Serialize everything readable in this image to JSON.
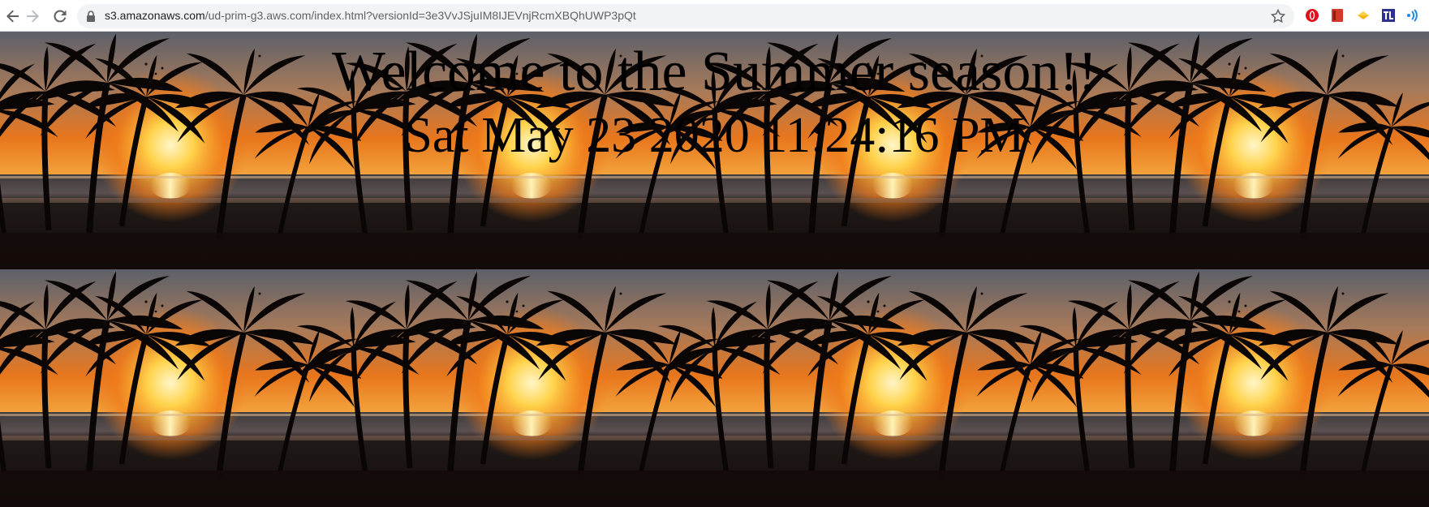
{
  "browser": {
    "url_host": "s3.amazonaws.com",
    "url_path": "/ud-prim-g3.aws.com/index.html?versionId=3e3VvJSjuIM8IJEVnjRcmXBQhUWP3pQt",
    "back_icon": "back-arrow-icon",
    "forward_icon": "forward-arrow-icon",
    "reload_icon": "reload-icon",
    "lock_icon": "lock-icon",
    "bookmark_icon": "star-icon",
    "extensions": [
      "opera-extension-icon",
      "red-book-extension-icon",
      "yellow-diamond-extension-icon",
      "tl-extension-icon",
      "blue-wave-extension-icon"
    ]
  },
  "page": {
    "heading": "Welcome to the Summer season!!",
    "datetime": "Sat May 23 2020 11:24:16 PM"
  },
  "colors": {
    "sky_top": "#6b6f78",
    "sun": "#ffd24a",
    "sunset_orange": "#e8761c",
    "sea": "#3d3a3c",
    "palm": "#0a0605"
  }
}
